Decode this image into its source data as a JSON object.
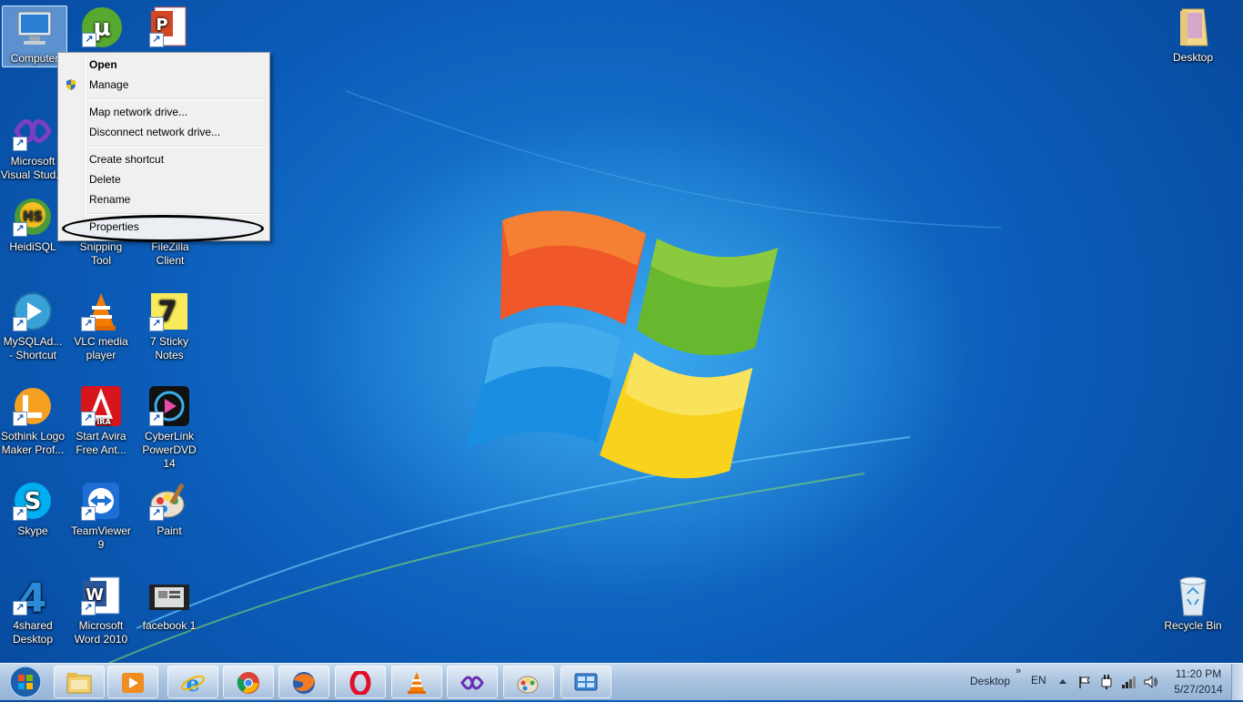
{
  "desktop_icons": [
    {
      "id": "computer",
      "label": "Computer",
      "icon": "computer-icon",
      "selected": true
    },
    {
      "id": "utorrent",
      "label": "",
      "icon": "utorrent-icon"
    },
    {
      "id": "powerpoint",
      "label": "",
      "icon": "powerpoint-icon"
    },
    {
      "id": "visualstudio",
      "label": "Microsoft Visual Stud...",
      "icon": "visual-studio-icon"
    },
    {
      "id": "heidisql",
      "label": "HeidiSQL",
      "icon": "heidisql-icon"
    },
    {
      "id": "snipping",
      "label": "Snipping Tool",
      "icon": "snipping-tool-icon"
    },
    {
      "id": "filezilla",
      "label": "FileZilla Client",
      "icon": "filezilla-icon"
    },
    {
      "id": "mysqlad",
      "label": "MySQLAd... - Shortcut",
      "icon": "mysql-admin-icon"
    },
    {
      "id": "vlc",
      "label": "VLC media player",
      "icon": "vlc-icon"
    },
    {
      "id": "stickynotes",
      "label": "7 Sticky Notes",
      "icon": "sticky-notes-icon"
    },
    {
      "id": "sothink",
      "label": "Sothink Logo Maker Prof...",
      "icon": "sothink-icon"
    },
    {
      "id": "avira",
      "label": "Start Avira Free Ant...",
      "icon": "avira-icon"
    },
    {
      "id": "powerdvd",
      "label": "CyberLink PowerDVD 14",
      "icon": "powerdvd-icon"
    },
    {
      "id": "skype",
      "label": "Skype",
      "icon": "skype-icon"
    },
    {
      "id": "teamviewer",
      "label": "TeamViewer 9",
      "icon": "teamviewer-icon"
    },
    {
      "id": "paint",
      "label": "Paint",
      "icon": "paint-icon"
    },
    {
      "id": "4shared",
      "label": "4shared Desktop",
      "icon": "4shared-icon"
    },
    {
      "id": "word",
      "label": "Microsoft Word 2010",
      "icon": "word-icon"
    },
    {
      "id": "facebook",
      "label": "facebook 1",
      "icon": "video-file-icon"
    },
    {
      "id": "desktopfolder",
      "label": "Desktop",
      "icon": "user-folder-icon"
    },
    {
      "id": "recyclebin",
      "label": "Recycle Bin",
      "icon": "recycle-bin-icon"
    }
  ],
  "context_menu": {
    "items": [
      {
        "label": "Open",
        "bold": true
      },
      {
        "label": "Manage",
        "icon": "uac-shield-icon"
      },
      {
        "label": "Map network drive..."
      },
      {
        "label": "Disconnect network drive..."
      },
      {
        "label": "Create shortcut"
      },
      {
        "label": "Delete"
      },
      {
        "label": "Rename"
      },
      {
        "label": "Properties",
        "highlighted": true
      }
    ]
  },
  "taskbar": {
    "pinned": [
      "explorer-icon",
      "media-player-icon",
      "internet-explorer-icon",
      "chrome-icon",
      "firefox-icon",
      "opera-icon",
      "vlc-icon",
      "visual-studio-icon",
      "paint-icon",
      "control-panel-icon"
    ],
    "toolbar_label": "Desktop",
    "chevron": "»",
    "language": "EN",
    "time": "11:20 PM",
    "date": "5/27/2014"
  },
  "colors": {
    "desktop": "#0b5cb8",
    "taskbar": "#a9c3df",
    "menu": "#f0f0f0"
  }
}
